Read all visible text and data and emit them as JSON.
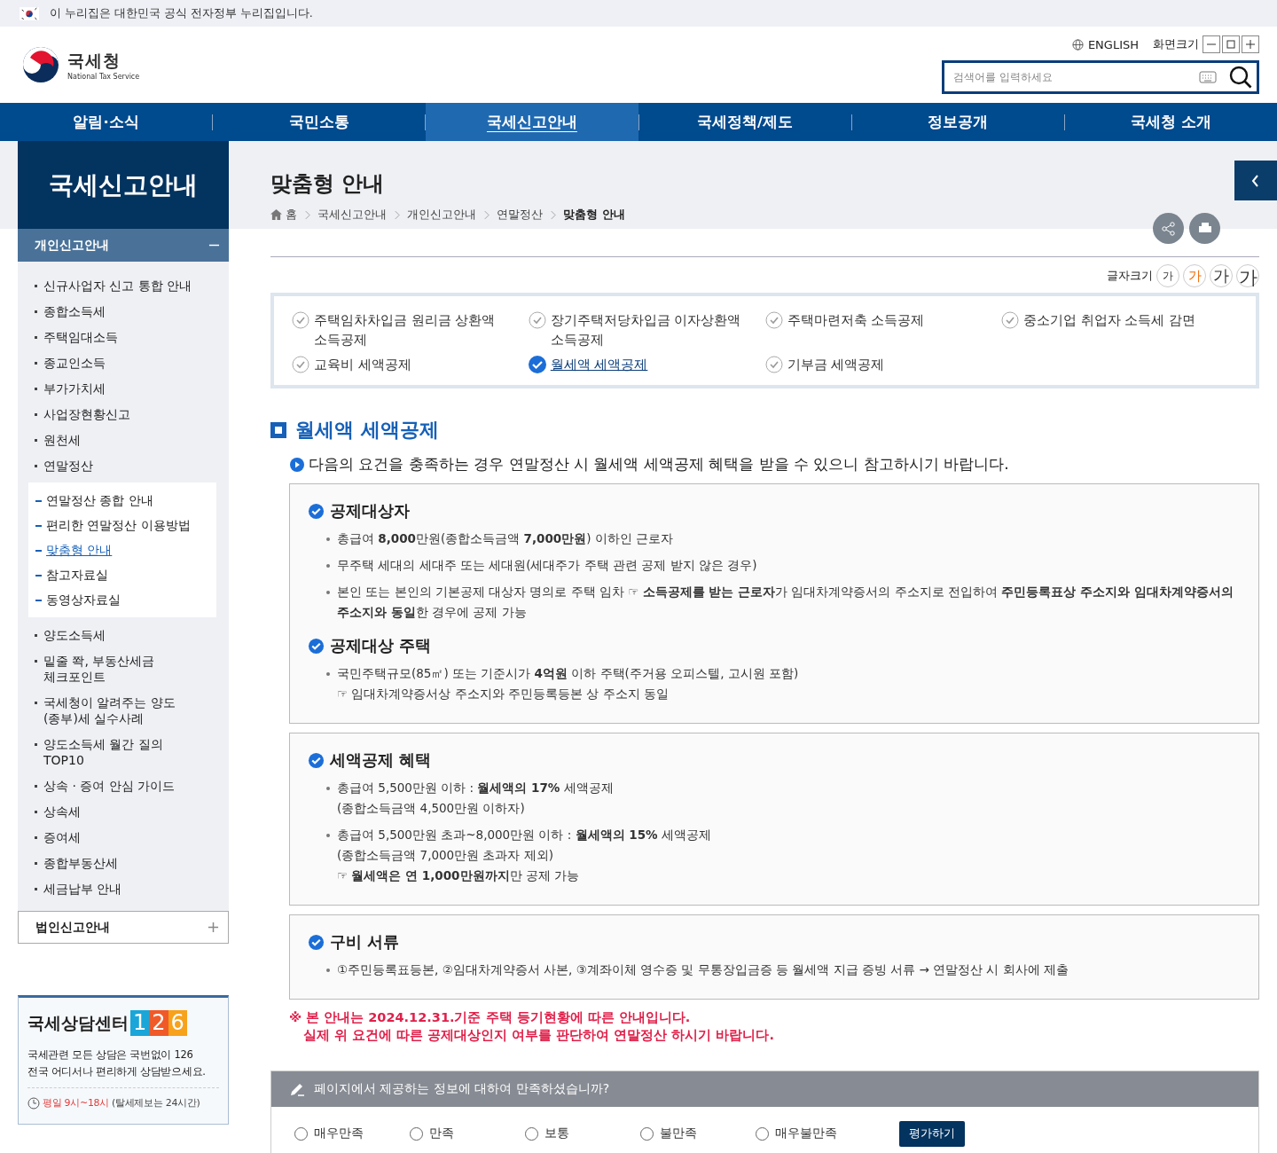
{
  "gov_banner": {
    "text": "이 누리집은 대한민국 공식 전자정부 누리집입니다."
  },
  "logo": {
    "name": "국세청",
    "subtitle": "National Tax Service"
  },
  "utility": {
    "language": "ENGLISH",
    "zoom_label": "화면크기"
  },
  "search": {
    "placeholder": "검색어를 입력하세요"
  },
  "nav": [
    {
      "label": "알림·소식",
      "selected": false
    },
    {
      "label": "국민소통",
      "selected": false
    },
    {
      "label": "국세신고안내",
      "selected": true
    },
    {
      "label": "국세정책/제도",
      "selected": false
    },
    {
      "label": "정보공개",
      "selected": false
    },
    {
      "label": "국세청 소개",
      "selected": false
    }
  ],
  "sidebar": {
    "title": "국세신고안내",
    "sections": [
      {
        "label": "개인신고안내",
        "expanded": true,
        "items": [
          {
            "label": "신규사업자 신고 통합 안내"
          },
          {
            "label": "종합소득세"
          },
          {
            "label": "주택임대소득"
          },
          {
            "label": "종교인소득"
          },
          {
            "label": "부가가치세"
          },
          {
            "label": "사업장현황신고"
          },
          {
            "label": "원천세"
          },
          {
            "label": "연말정산",
            "children": [
              {
                "label": "연말정산 종합 안내",
                "selected": false
              },
              {
                "label": "편리한 연말정산 이용방법",
                "selected": false
              },
              {
                "label": "맞춤형 안내",
                "selected": true
              },
              {
                "label": "참고자료실",
                "selected": false
              },
              {
                "label": "동영상자료실",
                "selected": false
              }
            ]
          },
          {
            "label": "양도소득세"
          },
          {
            "label": "밑줄 쫙, 부동산세금\n체크포인트"
          },
          {
            "label": "국세청이 알려주는 양도\n(종부)세 실수사례"
          },
          {
            "label": "양도소득세 월간 질의\nTOP10"
          },
          {
            "label": "상속 · 증여 안심 가이드"
          },
          {
            "label": "상속세"
          },
          {
            "label": "증여세"
          },
          {
            "label": "종합부동산세"
          },
          {
            "label": "세금납부 안내"
          }
        ]
      },
      {
        "label": "법인신고안내",
        "expanded": false
      }
    ]
  },
  "consult": {
    "title": "국세상담센터",
    "number": "126",
    "lines": [
      "국세관련 모든 상담은 국번없이 126",
      "전국 어디서나 편리하게 상담받으세요."
    ],
    "hours": "평일 9시~18시",
    "hours_note": "(탈세제보는 24시간)"
  },
  "page_title": "맞춤형 안내",
  "breadcrumb": [
    "홈",
    "국세신고안내",
    "개인신고안내",
    "연말정산",
    "맞춤형 안내"
  ],
  "font_size": {
    "label": "글자크기",
    "options": [
      {
        "label": "가",
        "selected": false
      },
      {
        "label": "가",
        "selected": true
      },
      {
        "label": "가",
        "selected": false
      },
      {
        "label": "가",
        "selected": false
      }
    ]
  },
  "topic_tabs": [
    {
      "label": "주택임차차입금 원리금 상환액\n소득공제",
      "selected": false
    },
    {
      "label": "장기주택저당차입금 이자상환액\n소득공제",
      "selected": false
    },
    {
      "label": "주택마련저축 소득공제",
      "selected": false
    },
    {
      "label": "중소기업 취업자 소득세 감면",
      "selected": false
    },
    {
      "label": "교육비 세액공제",
      "selected": false
    },
    {
      "label": "월세액 세액공제",
      "selected": true
    },
    {
      "label": "기부금 세액공제",
      "selected": false
    }
  ],
  "section_title": "월세액 세액공제",
  "intro": "다음의 요건을 충족하는 경우 연말정산 시 월세액 세액공제 혜택을 받을 수 있으니 참고하시기 바랍니다.",
  "boxes": [
    {
      "sections": [
        {
          "heading": "공제대상자",
          "bullets": [
            {
              "text": "총급여 **8,000**만원(종합소득금액 **7,000만원**) 이하인 근로자"
            },
            {
              "text": "무주택 세대의 세대주 또는 세대원(세대주가 주택 관련 공제 받지 않은 경우)"
            },
            {
              "text": "본인 또는 본인의 기본공제 대상자 명의로 주택 임차 ☞ **소득공제를 받는 근로자**가 임대차계약증서의 주소지로 전입하여 **주민등록표상 주소지와 임대차계약증서의 주소지와 동일**한 경우에 공제 가능"
            }
          ]
        },
        {
          "heading": "공제대상 주택",
          "bullets": [
            {
              "text": "국민주택규모(85㎡) 또는 기준시가 **4억원** 이하 주택(주거용 오피스텔, 고시원 포함)",
              "lines": [
                "☞ 임대차계약증서상 주소지와 주민등록등본 상 주소지 동일"
              ]
            }
          ]
        }
      ]
    },
    {
      "sections": [
        {
          "heading": "세액공제 혜택",
          "bullets": [
            {
              "text": "총급여 5,500만원 이하 : **월세액의 17%** 세액공제",
              "lines": [
                "(종합소득금액 4,500만원 이하자)"
              ]
            },
            {
              "text": "총급여 5,500만원 초과~8,000만원 이하 : **월세액의 15%** 세액공제",
              "lines": [
                "(종합소득금액 7,000만원 초과자 제외)",
                "☞ **월세액은 연 1,000만원까지**만 공제 가능"
              ]
            }
          ]
        }
      ]
    },
    {
      "sections": [
        {
          "heading": "구비 서류",
          "bullets": [
            {
              "text": "①주민등록표등본, ②임대차계약증서 사본, ③계좌이체 영수증 및 무통장입금증 등 월세액 지급 증빙 서류 → 연말정산 시 회사에 제출"
            }
          ]
        }
      ]
    }
  ],
  "notice": [
    "※ 본 안내는 2024.12.31.기준 주택 등기현황에 따른 안내입니다.",
    "실제 위 요건에 따른 공제대상인지 여부를 판단하여 연말정산 하시기 바랍니다."
  ],
  "survey": {
    "question": "페이지에서 제공하는 정보에 대하여 만족하셨습니까?",
    "options": [
      {
        "label": "매우만족",
        "selected": false
      },
      {
        "label": "만족",
        "selected": false
      },
      {
        "label": "보통",
        "selected": false
      },
      {
        "label": "불만족",
        "selected": false
      },
      {
        "label": "매우불만족",
        "selected": false
      }
    ],
    "button": "평가하기"
  }
}
